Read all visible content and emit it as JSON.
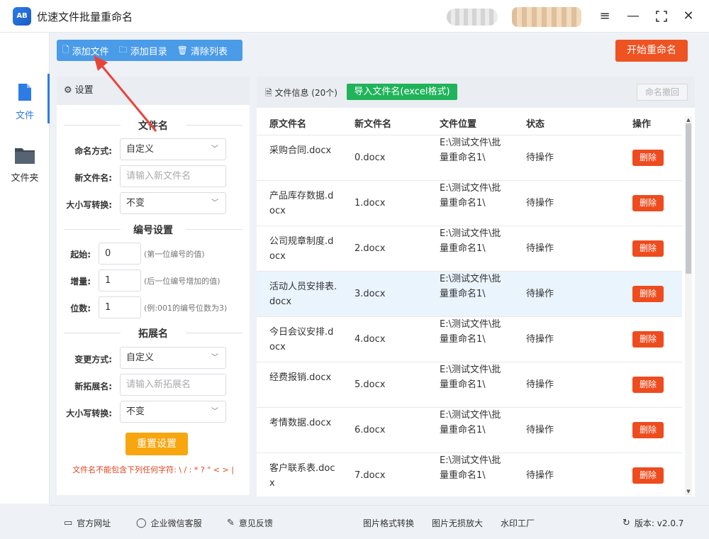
{
  "app": {
    "title": "优速文件批量重命名",
    "logo_text": "AB"
  },
  "window_controls": {
    "menu_icon": "menu-icon",
    "min_icon": "minimize-icon",
    "max_icon": "maximize-icon",
    "close_icon": "close-icon"
  },
  "leftnav": {
    "items": [
      {
        "label": "文件",
        "icon": "file-icon",
        "active": true
      },
      {
        "label": "文件夹",
        "icon": "folder-icon",
        "active": false
      }
    ]
  },
  "toolbar": {
    "add_file": "添加文件",
    "add_dir": "添加目录",
    "clear_list": "清除列表",
    "start": "开始重命名"
  },
  "settings": {
    "header": "设置",
    "filename_section": "文件名",
    "naming_mode_label": "命名方式:",
    "naming_mode_value": "自定义",
    "new_name_label": "新文件名:",
    "new_name_placeholder": "请输入新文件名",
    "case_label": "大小写转换:",
    "case_value": "不变",
    "numbering_section": "编号设置",
    "start_label": "起始:",
    "start_value": "0",
    "start_hint": "(第一位编号的值)",
    "step_label": "增量:",
    "step_value": "1",
    "step_hint": "(后一位编号增加的值)",
    "digits_label": "位数:",
    "digits_value": "1",
    "digits_hint": "(例:001的编号位数为3)",
    "ext_section": "拓展名",
    "ext_mode_label": "变更方式:",
    "ext_mode_value": "自定义",
    "new_ext_label": "新拓展名:",
    "new_ext_placeholder": "请输入新拓展名",
    "ext_case_label": "大小写转换:",
    "ext_case_value": "不变",
    "reset_button": "重置设置",
    "warning": "文件名不能包含下列任何字符: \\ / : * ? \" < > |"
  },
  "filelist": {
    "title": "文件信息 (20个)",
    "import_button": "导入文件名(excel格式)",
    "undo_button": "命名撤回",
    "columns": {
      "orig": "原文件名",
      "new": "新文件名",
      "location": "文件位置",
      "status": "状态",
      "action": "操作"
    },
    "rows": [
      {
        "orig": "采购合同.docx",
        "new": "0.docx",
        "location": "E:\\测试文件\\批量重命名1\\",
        "status": "待操作",
        "action": "删除"
      },
      {
        "orig": "产品库存数据.docx",
        "new": "1.docx",
        "location": "E:\\测试文件\\批量重命名1\\",
        "status": "待操作",
        "action": "删除"
      },
      {
        "orig": "公司规章制度.docx",
        "new": "2.docx",
        "location": "E:\\测试文件\\批量重命名1\\",
        "status": "待操作",
        "action": "删除"
      },
      {
        "orig": "活动人员安排表.docx",
        "new": "3.docx",
        "location": "E:\\测试文件\\批量重命名1\\",
        "status": "待操作",
        "action": "删除"
      },
      {
        "orig": "今日会议安排.docx",
        "new": "4.docx",
        "location": "E:\\测试文件\\批量重命名1\\",
        "status": "待操作",
        "action": "删除"
      },
      {
        "orig": "经费报销.docx",
        "new": "5.docx",
        "location": "E:\\测试文件\\批量重命名1\\",
        "status": "待操作",
        "action": "删除"
      },
      {
        "orig": "考情数据.docx",
        "new": "6.docx",
        "location": "E:\\测试文件\\批量重命名1\\",
        "status": "待操作",
        "action": "删除"
      },
      {
        "orig": "客户联系表.docx",
        "new": "7.docx",
        "location": "E:\\测试文件\\批量重命名1\\",
        "status": "待操作",
        "action": "删除"
      }
    ]
  },
  "footer": {
    "website": "官方网址",
    "wechat": "企业微信客服",
    "feedback": "意见反馈",
    "img_convert": "图片格式转换",
    "img_enlarge": "图片无损放大",
    "watermark": "水印工厂",
    "version": "版本: v2.0.7"
  },
  "colors": {
    "accent_blue": "#2d7be5",
    "toolbar_blue": "#4a9be8",
    "start_orange": "#ee5322",
    "import_green": "#20b35a",
    "delete_red": "#ee4b1e",
    "reset_yellow": "#f7a60f",
    "arrow_red": "#e8453a"
  }
}
